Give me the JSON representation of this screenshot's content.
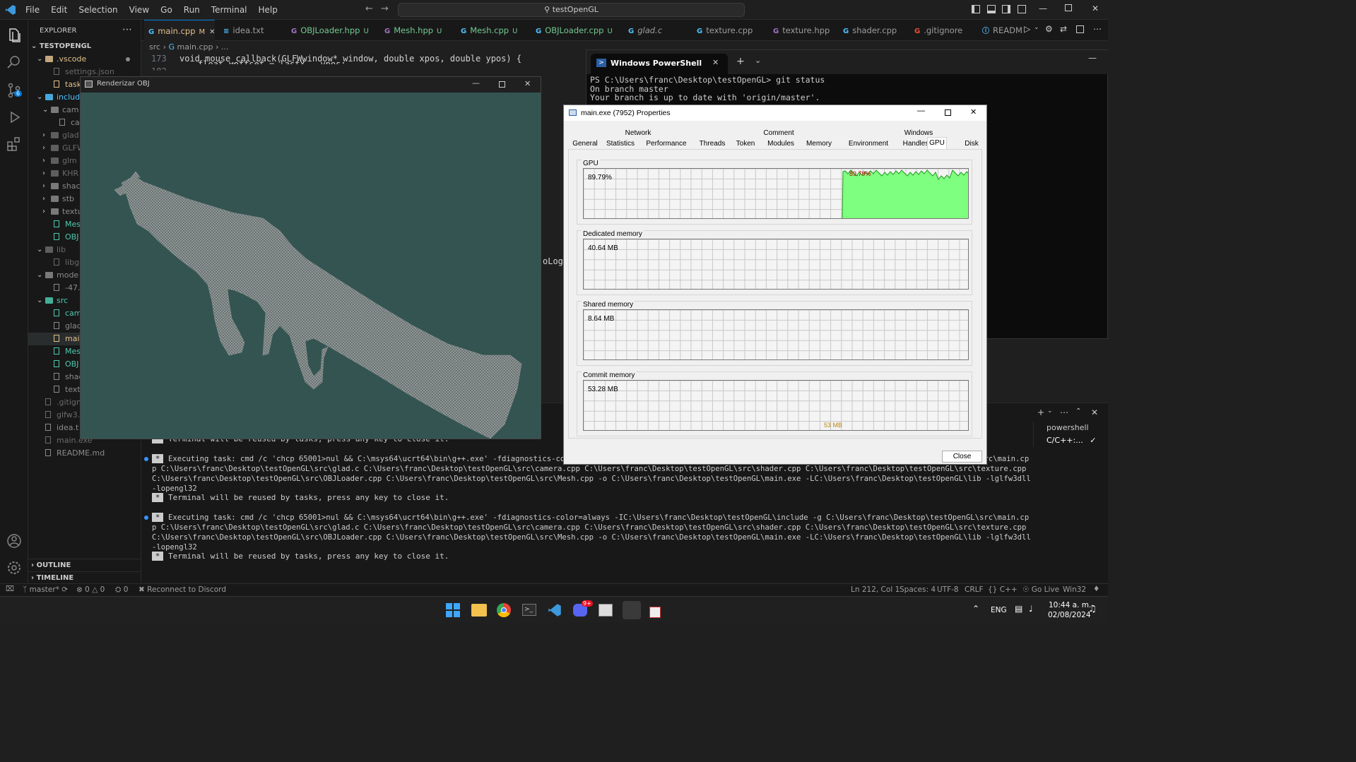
{
  "titlebar": {
    "menu": [
      "File",
      "Edit",
      "Selection",
      "View",
      "Go",
      "Run",
      "Terminal",
      "Help"
    ],
    "search": "testOpenGL"
  },
  "sidebar": {
    "header": "EXPLORER",
    "root": "TESTOPENGL",
    "items": [
      {
        "label": ".vscode",
        "color": "#e2c08d"
      },
      {
        "label": "settings.json",
        "color": "#6b6b6b"
      },
      {
        "label": "tasks",
        "color": "#e2c08d"
      },
      {
        "label": "include",
        "color": "#4fc1ff"
      },
      {
        "label": "cam",
        "color": "#8b8b8b"
      },
      {
        "label": "car",
        "color": "#8b8b8b"
      },
      {
        "label": "glad",
        "color": "#6b6b6b"
      },
      {
        "label": "GLFW",
        "color": "#6b6b6b"
      },
      {
        "label": "glm",
        "color": "#6b6b6b"
      },
      {
        "label": "KHR",
        "color": "#6b6b6b"
      },
      {
        "label": "shac",
        "color": "#8b8b8b"
      },
      {
        "label": "stb",
        "color": "#8b8b8b"
      },
      {
        "label": "textu",
        "color": "#8b8b8b"
      },
      {
        "label": "Mes",
        "color": "#4ec9b0"
      },
      {
        "label": "OBJ",
        "color": "#4ec9b0"
      },
      {
        "label": "lib",
        "color": "#6b6b6b"
      },
      {
        "label": "libgl",
        "color": "#6b6b6b"
      },
      {
        "label": "mode",
        "color": "#8b8b8b"
      },
      {
        "label": "-47.c",
        "color": "#8b8b8b"
      },
      {
        "label": "src",
        "color": "#4ec9b0"
      },
      {
        "label": "cam",
        "color": "#4ec9b0"
      },
      {
        "label": "glad",
        "color": "#8b8b8b"
      },
      {
        "label": "mair",
        "color": "#e2c08d"
      },
      {
        "label": "Mes",
        "color": "#4ec9b0"
      },
      {
        "label": "OBJ",
        "color": "#4ec9b0"
      },
      {
        "label": "shac",
        "color": "#8b8b8b"
      },
      {
        "label": "textu",
        "color": "#8b8b8b"
      },
      {
        "label": ".gitign",
        "color": "#6b6b6b"
      },
      {
        "label": "glfw3.",
        "color": "#6b6b6b"
      },
      {
        "label": "idea.t",
        "color": "#8b8b8b"
      },
      {
        "label": "main.exe",
        "color": "#6b6b6b"
      },
      {
        "label": "README.md",
        "color": "#8b8b8b"
      }
    ],
    "outline": "OUTLINE",
    "timeline": "TIMELINE"
  },
  "tabs": [
    {
      "label": "main.cpp",
      "badge": "M",
      "active": true
    },
    {
      "label": "idea.txt",
      "badge": ""
    },
    {
      "label": "OBJLoader.hpp",
      "badge": "U"
    },
    {
      "label": "Mesh.hpp",
      "badge": "U"
    },
    {
      "label": "Mesh.cpp",
      "badge": "U"
    },
    {
      "label": "OBJLoader.cpp",
      "badge": "U"
    },
    {
      "label": "glad.c",
      "badge": ""
    },
    {
      "label": "texture.cpp",
      "badge": ""
    },
    {
      "label": "texture.hpp",
      "badge": ""
    },
    {
      "label": "shader.cpp",
      "badge": ""
    },
    {
      "label": ".gitignore",
      "badge": ""
    },
    {
      "label": "READM",
      "badge": ""
    }
  ],
  "editor": {
    "breadcrumb": [
      "src",
      "main.cpp",
      "..."
    ],
    "line_no": "173",
    "code": "void mouse_callback(GLFWwindow* window, double xpos, double ypos) {",
    "code2": "float yoffset = lastY - ypos;",
    "line_no2": "182",
    "fragment": "oLog"
  },
  "powershell": {
    "tab": "Windows PowerShell",
    "lines": [
      "PS C:\\Users\\franc\\Desktop\\testOpenGL> git status",
      "On branch master",
      "Your branch is up to date with 'origin/master'."
    ]
  },
  "render_window": {
    "title": "Renderizar OBJ"
  },
  "properties": {
    "title": "main.exe (7952) Properties",
    "tabs_row1": [
      "Network",
      "Comment",
      "Windows"
    ],
    "tabs_row2": [
      "General",
      "Statistics",
      "Performance",
      "Threads",
      "Token",
      "Modules",
      "Memory",
      "Environment",
      "Handles",
      "GPU",
      "Disk"
    ],
    "active_tab": "GPU",
    "groups": [
      {
        "label": "GPU",
        "value": "89.79%",
        "overlay": "89.79%"
      },
      {
        "label": "Dedicated memory",
        "value": "40.64 MB"
      },
      {
        "label": "Shared memory",
        "value": "8.64 MB"
      },
      {
        "label": "Commit memory",
        "value": "53.28 MB",
        "marker": "53 MB"
      }
    ],
    "close": "Close"
  },
  "terminal": {
    "lines": [
      {
        "type": "notice",
        "text": "Terminal will be reused by tasks, press any key to close it."
      },
      {
        "type": "task",
        "text": "Executing task: cmd /c 'chcp 65001>nul && C:\\msys64\\ucrt64\\bin\\g++.exe' -fdiagnostics-color=always -IC:\\Users\\franc\\Desktop\\testOpenGL\\include -g C:\\Users\\franc\\Desktop\\testOpenGL\\src\\main.cpp C:\\Users\\franc\\Desktop\\testOpenGL\\src\\glad.c C:\\Users\\franc\\Desktop\\testOpenGL\\src\\camera.cpp C:\\Users\\franc\\Desktop\\testOpenGL\\src\\shader.cpp C:\\Users\\franc\\Desktop\\testOpenGL\\src\\texture.cpp C:\\Users\\franc\\Desktop\\testOpenGL\\src\\OBJLoader.cpp C:\\Users\\franc\\Desktop\\testOpenGL\\src\\Mesh.cpp -o C:\\Users\\franc\\Desktop\\testOpenGL\\main.exe -LC:\\Users\\franc\\Desktop\\testOpenGL\\lib -lglfw3dll -lopengl32"
      },
      {
        "type": "notice",
        "text": "Terminal will be reused by tasks, press any key to close it."
      },
      {
        "type": "task",
        "text": "Executing task: cmd /c 'chcp 65001>nul && C:\\msys64\\ucrt64\\bin\\g++.exe' -fdiagnostics-color=always -IC:\\Users\\franc\\Desktop\\testOpenGL\\include -g C:\\Users\\franc\\Desktop\\testOpenGL\\src\\main.cpp C:\\Users\\franc\\Desktop\\testOpenGL\\src\\glad.c C:\\Users\\franc\\Desktop\\testOpenGL\\src\\camera.cpp C:\\Users\\franc\\Desktop\\testOpenGL\\src\\shader.cpp C:\\Users\\franc\\Desktop\\testOpenGL\\src\\texture.cpp C:\\Users\\franc\\Desktop\\testOpenGL\\src\\OBJLoader.cpp C:\\Users\\franc\\Desktop\\testOpenGL\\src\\Mesh.cpp -o C:\\Users\\franc\\Desktop\\testOpenGL\\main.exe -LC:\\Users\\franc\\Desktop\\testOpenGL\\lib -lglfw3dll -lopengl32"
      },
      {
        "type": "notice",
        "text": "Terminal will be reused by tasks, press any key to close it."
      }
    ],
    "side_items": [
      "powershell",
      "C/C++:..."
    ]
  },
  "statusbar": {
    "branch": "master*",
    "errors": "0",
    "warnings": "0",
    "ports": "0",
    "discord": "Reconnect to Discord",
    "position": "Ln 212, Col 1",
    "spaces": "Spaces: 4",
    "encoding": "UTF-8",
    "eol": "CRLF",
    "language": "C++",
    "golive": "Go Live",
    "platform": "Win32"
  },
  "taskbar": {
    "lang": "ENG",
    "time": "10:44 a. m.",
    "date": "02/08/2024",
    "badge": "9+"
  },
  "colors": {
    "accent": "#0078d4",
    "gpu_fill": "#7fff7f",
    "render_bg": "#345452"
  }
}
